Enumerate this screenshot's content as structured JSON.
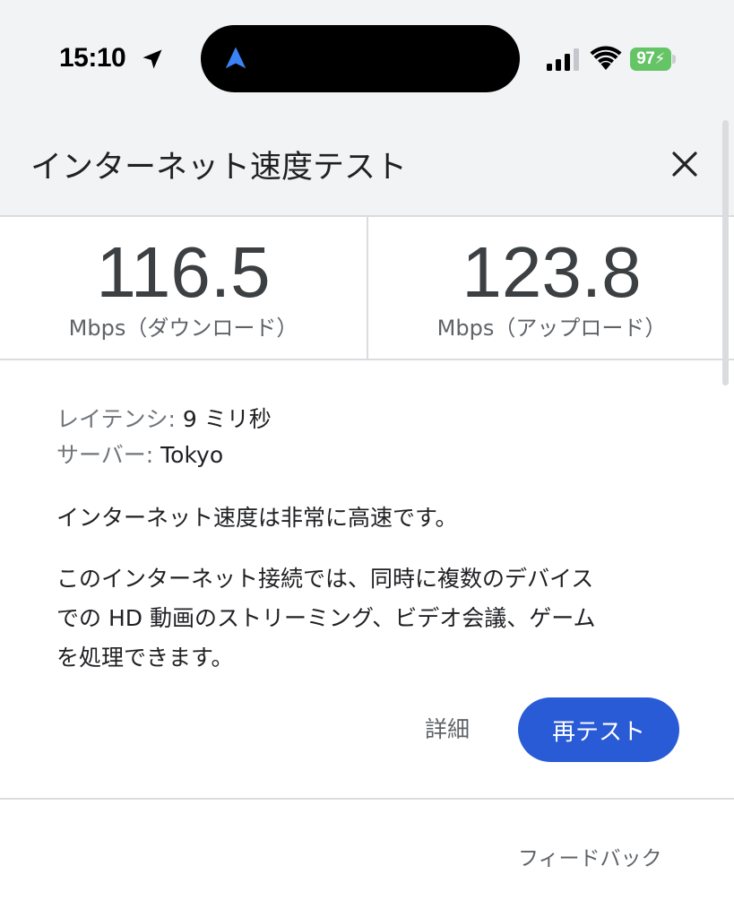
{
  "status_bar": {
    "time": "15:10",
    "battery_level": "97",
    "battery_color": "#65c466",
    "icons": [
      "location-arrow-icon",
      "navigation-arrow-icon",
      "signal-bars-icon",
      "wifi-icon",
      "battery-charging-icon"
    ]
  },
  "header": {
    "title": "インターネット速度テスト",
    "close_icon": "close-icon"
  },
  "results": {
    "download": {
      "value": "116.5",
      "unit": "Mbps（ダウンロード）"
    },
    "upload": {
      "value": "123.8",
      "unit": "Mbps（アップロード）"
    }
  },
  "details": {
    "latency_label": "レイテンシ:",
    "latency_value": "9 ミリ秒",
    "server_label": "サーバー:",
    "server_value": "Tokyo"
  },
  "summary": "インターネット速度は非常に高速です。",
  "description_lines": [
    "このインターネット接続では、同時に複数のデバイス",
    "での HD 動画のストリーミング、ビデオ会議、ゲーム",
    "を処理できます。"
  ],
  "actions": {
    "details_label": "詳細",
    "retest_label": "再テスト",
    "retest_color": "#2a5bd7"
  },
  "footer": {
    "feedback_label": "フィードバック"
  }
}
